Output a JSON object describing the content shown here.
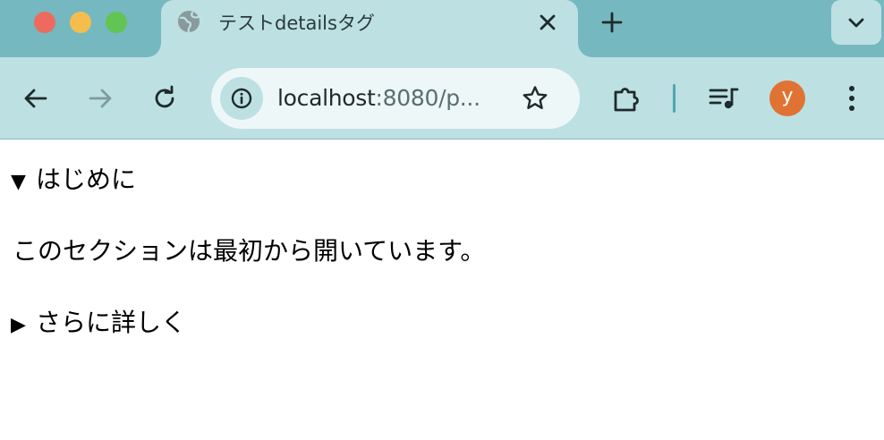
{
  "browser": {
    "tab": {
      "title": "テストdetailsタグ",
      "favicon": "globe-icon"
    },
    "address_bar": {
      "host": "localhost",
      "rest": ":8080/p..."
    },
    "profile": {
      "initial": "y",
      "color": "#e07333"
    },
    "colors": {
      "tabstrip": "#75b8c0",
      "toolbar": "#bde0e3",
      "omnibox": "#eef7f8"
    }
  },
  "page": {
    "details_open": {
      "open": true,
      "marker": "▼",
      "summary": "はじめに",
      "content": "このセクションは最初から開いています。"
    },
    "details_closed": {
      "open": false,
      "marker": "▶",
      "summary": "さらに詳しく"
    }
  }
}
